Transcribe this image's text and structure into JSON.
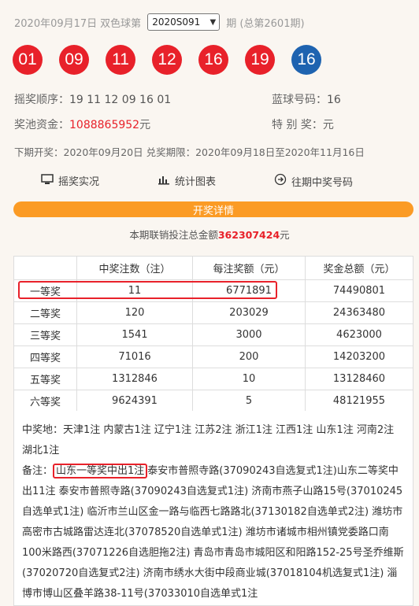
{
  "header": {
    "date": "2020年09月17日",
    "lottery_name": "双色球第",
    "issue_selected": "2020S091",
    "issue_suffix": "期 (总第2601期)"
  },
  "balls": {
    "red": [
      "01",
      "09",
      "11",
      "12",
      "16",
      "19"
    ],
    "blue": "16",
    "colors": {
      "red": "#e8212a",
      "blue": "#1e63b0"
    }
  },
  "info": {
    "order_label": "摇奖顺序：",
    "order_value": "19 11 12 09 16 01",
    "blue_label": "蓝球号码：",
    "blue_value": "16",
    "pool_label": "奖池资金：",
    "pool_value": "1088865952",
    "pool_unit": "元",
    "special_label": "特 别 奖：",
    "special_value": "元",
    "next_draw": "下期开奖：2020年09月20日 兑奖期限：2020年09月18日至2020年11月16日"
  },
  "links": {
    "live": "摇奖实况",
    "chart": "统计图表",
    "history": "往期中奖号码"
  },
  "detail_button": "开奖详情",
  "sales": {
    "prefix": "本期联销投注总金额",
    "amount": "362307424",
    "unit": "元"
  },
  "table": {
    "headers": [
      "",
      "中奖注数（注）",
      "每注奖额（元）",
      "奖金总额（元）"
    ],
    "rows": [
      [
        "一等奖",
        "11",
        "6771891",
        "74490801"
      ],
      [
        "二等奖",
        "120",
        "203029",
        "24363480"
      ],
      [
        "三等奖",
        "1541",
        "3000",
        "4623000"
      ],
      [
        "四等奖",
        "71016",
        "200",
        "14203200"
      ],
      [
        "五等奖",
        "1312846",
        "10",
        "13128460"
      ],
      [
        "六等奖",
        "9624391",
        "5",
        "48121955"
      ]
    ]
  },
  "winners": {
    "location_label": "中奖地：",
    "location_text": "天津1注 内蒙古1注 辽宁1注 江苏2注 浙江1注 江西1注 山东1注 河南2注 湖北1注",
    "note_label": "备注：",
    "note_highlight": "山东一等奖中出1注",
    "note_text": "泰安市普照寺路(37090243自选复式1注)山东二等奖中出11注 泰安市普照寺路(37090243自选复式1注) 济南市燕子山路15号(37010245自选单式1注) 临沂市兰山区金一路与临西七路路北(37130182自选单式2注) 潍坊市高密市古城路雷达连北(37078520自选单式1注) 潍坊市诸城市相州镇党委路口南100米路西(37071226自选胆拖2注) 青岛市青岛市城阳区和阳路152-25号圣乔维斯(37020720自选复式2注) 济南市绣水大街中段商业城(37018104机选复式1注) 淄博市博山区叠羊路38-11号(37033010自选单式1注"
  }
}
